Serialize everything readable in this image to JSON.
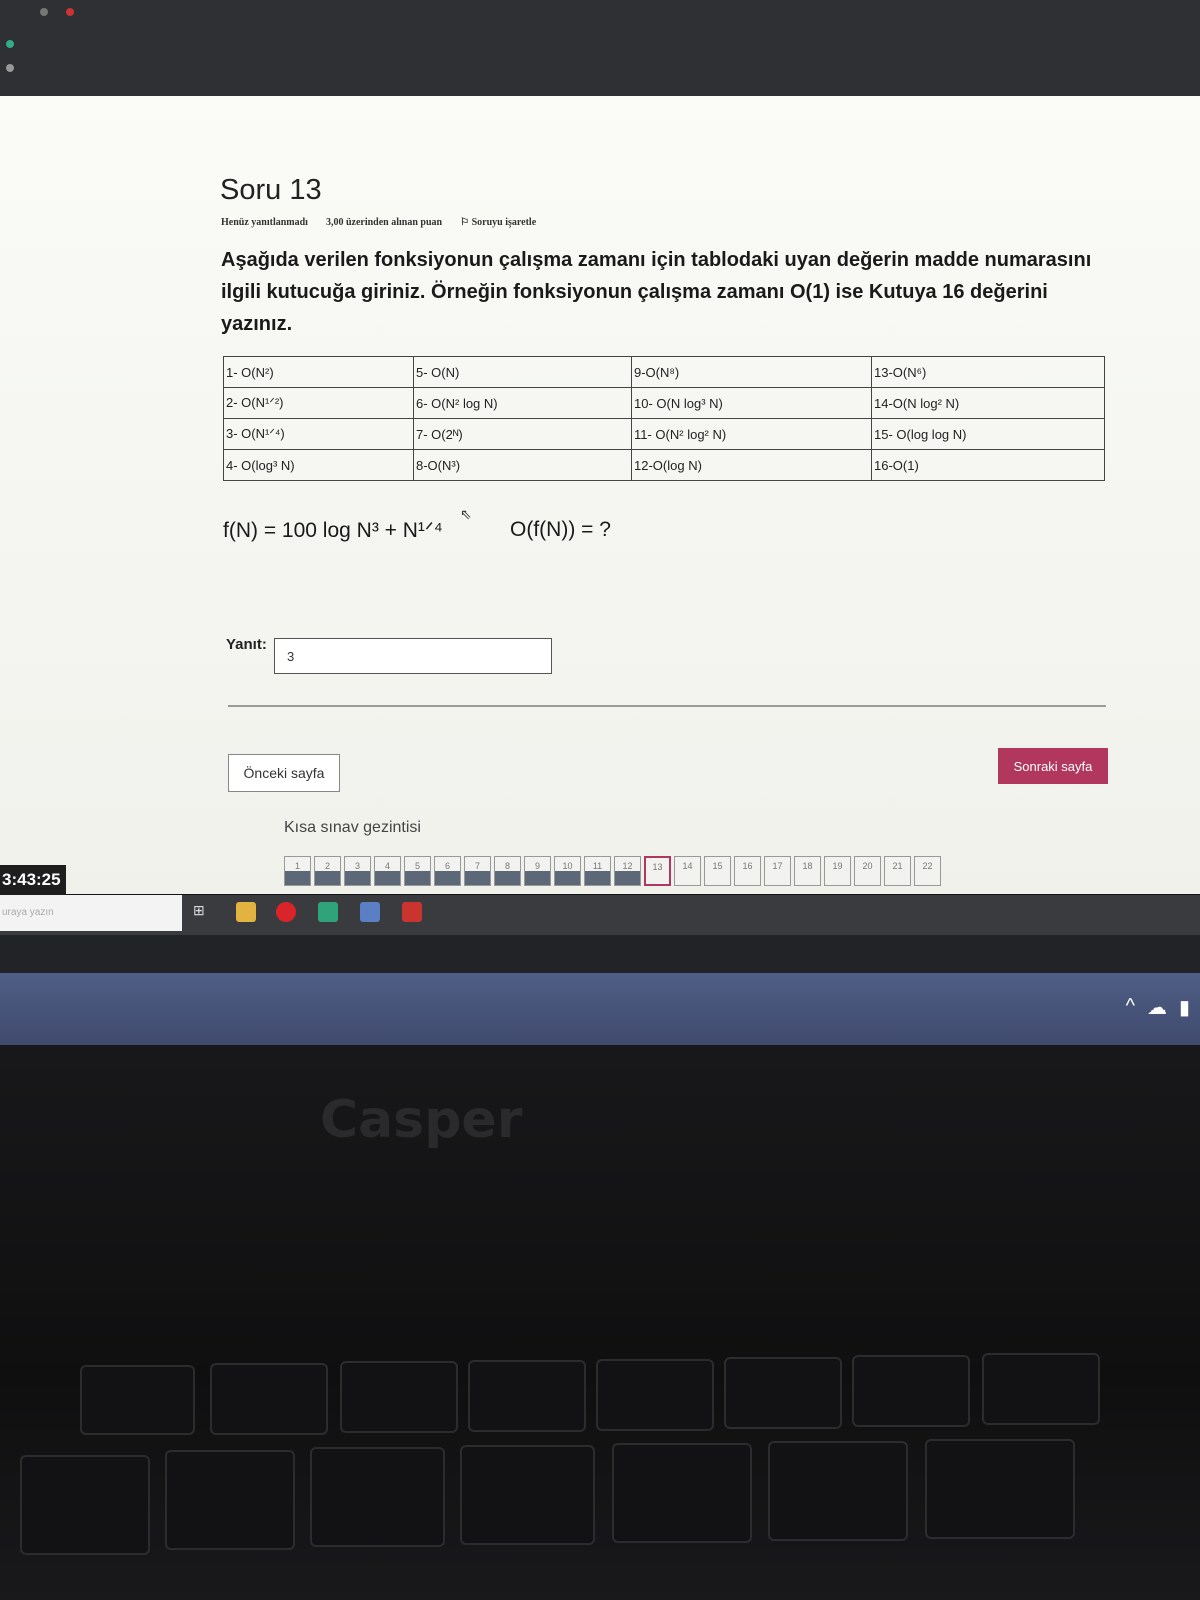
{
  "question": {
    "title": "Soru 13",
    "status": "Henüz yanıtlanmadı",
    "points": "3,00 üzerinden alınan puan",
    "flag": "Soruyu işaretle",
    "text": "Aşağıda verilen fonksiyonun çalışma zamanı için tablodaki uyan değerin madde numarasını ilgili kutucuğa giriniz. Örneğin fonksiyonun çalışma zamanı O(1) ise Kutuya 16 değerini yazınız."
  },
  "options_table": [
    [
      "1- O(N²)",
      "5- O(N)",
      "9-O(N⁸)",
      "13-O(N⁶)"
    ],
    [
      "2- O(N¹ᐟ²)",
      "6- O(N² log N)",
      "10- O(N log³ N)",
      "14-O(N log² N)"
    ],
    [
      "3- O(N¹ᐟ⁴)",
      "7- O(2ᴺ)",
      "11- O(N² log² N)",
      "15- O(log log N)"
    ],
    [
      "4- O(log³ N)",
      "8-O(N³)",
      "12-O(log N)",
      "16-O(1)"
    ]
  ],
  "formula": {
    "expression": "f(N) = 100 log N³  + N¹ᐟ⁴",
    "question": "O(f(N)) = ?"
  },
  "answer": {
    "label": "Yanıt:",
    "value": "3"
  },
  "buttons": {
    "prev": "Önceki sayfa",
    "next": "Sonraki sayfa"
  },
  "quiz_nav": {
    "title": "Kısa sınav gezintisi",
    "pages": [
      "1",
      "2",
      "3",
      "4",
      "5",
      "6",
      "7",
      "8",
      "9",
      "10",
      "11",
      "12",
      "13",
      "14",
      "15",
      "16",
      "17",
      "18",
      "19",
      "20",
      "21",
      "22"
    ],
    "answered": [
      1,
      2,
      3,
      4,
      5,
      6,
      7,
      8,
      9,
      10,
      11,
      12
    ],
    "current": 13
  },
  "clock": "3:43:25",
  "taskbar": {
    "search_placeholder": "uraya yazın"
  },
  "brand": "Casper",
  "colors": {
    "accent": "#b2375f",
    "answered_fill": "#5c6777"
  }
}
